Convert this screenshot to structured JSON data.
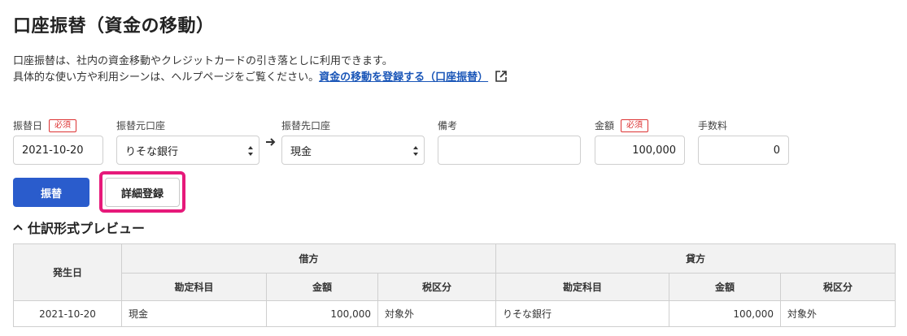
{
  "page_title": "口座振替（資金の移動）",
  "description": {
    "line1": "口座振替は、社内の資金移動やクレジットカードの引き落としに利用できます。",
    "line2_prefix": "具体的な使い方や利用シーンは、ヘルプページをご覧ください。",
    "help_link": "資金の移動を登録する（口座振替）"
  },
  "form": {
    "required_badge": "必須",
    "date": {
      "label": "振替日",
      "value": "2021-10-20"
    },
    "from_account": {
      "label": "振替元口座",
      "value": "りそな銀行"
    },
    "to_account": {
      "label": "振替先口座",
      "value": "現金"
    },
    "memo": {
      "label": "備考",
      "value": ""
    },
    "amount": {
      "label": "金額",
      "value": "100,000"
    },
    "fee": {
      "label": "手数料",
      "value": "0"
    }
  },
  "buttons": {
    "transfer": "振替",
    "detail_register": "詳細登録"
  },
  "preview": {
    "title": "仕訳形式プレビュー",
    "headers": {
      "date": "発生日",
      "debit": "借方",
      "credit": "貸方",
      "account": "勘定科目",
      "amount": "金額",
      "tax": "税区分"
    },
    "row": {
      "date": "2021-10-20",
      "debit_account": "現金",
      "debit_amount": "100,000",
      "debit_tax": "対象外",
      "credit_account": "りそな銀行",
      "credit_amount": "100,000",
      "credit_tax": "対象外"
    }
  },
  "colors": {
    "primary": "#2a5ccc",
    "highlight": "#e6197a",
    "required": "#dd3333",
    "link": "#1a56b8"
  }
}
